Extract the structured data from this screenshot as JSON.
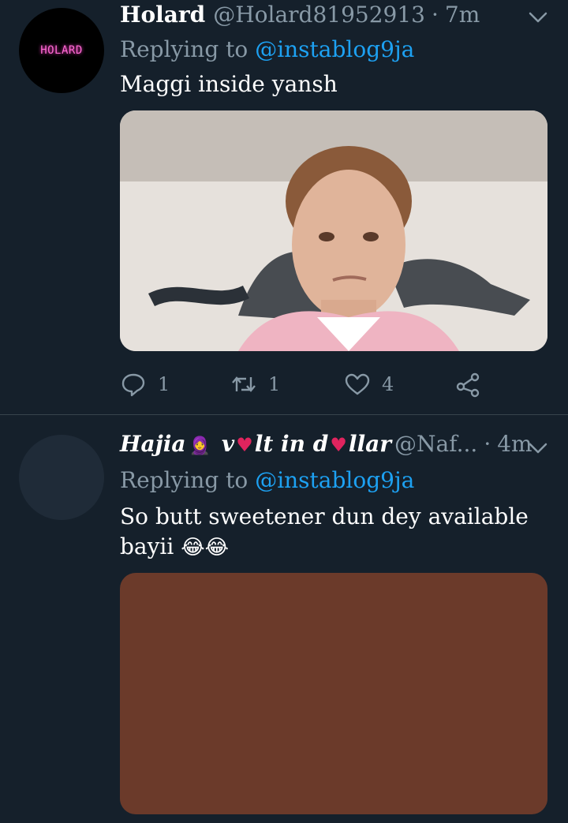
{
  "tweets": [
    {
      "avatar_text": "HOLARD",
      "display_name": "Holard",
      "handle": "@Holard81952913",
      "separator": "·",
      "time": "7m",
      "replying_prefix": "Replying to",
      "replying_to": "@instablog9ja",
      "text": "Maggi inside yansh",
      "actions": {
        "replies": "1",
        "retweets": "1",
        "likes": "4"
      }
    },
    {
      "display_name_parts": [
        "Hajia",
        "🧕",
        "v",
        "♥",
        "lt in d",
        "♥",
        "llar"
      ],
      "handle": "@Naf...",
      "separator": "·",
      "time": "4m",
      "replying_prefix": "Replying to",
      "replying_to": "@instablog9ja",
      "text": "So butt sweetener dun dey available bayii",
      "text_emoji": "😂😂"
    }
  ],
  "colors": {
    "background": "#15202b",
    "secondary_text": "#8899a6",
    "link": "#1da1f2",
    "media2_fill": "#6b3a2a"
  },
  "icons": [
    "chevron-down-icon",
    "reply-icon",
    "retweet-icon",
    "like-icon",
    "share-icon"
  ]
}
